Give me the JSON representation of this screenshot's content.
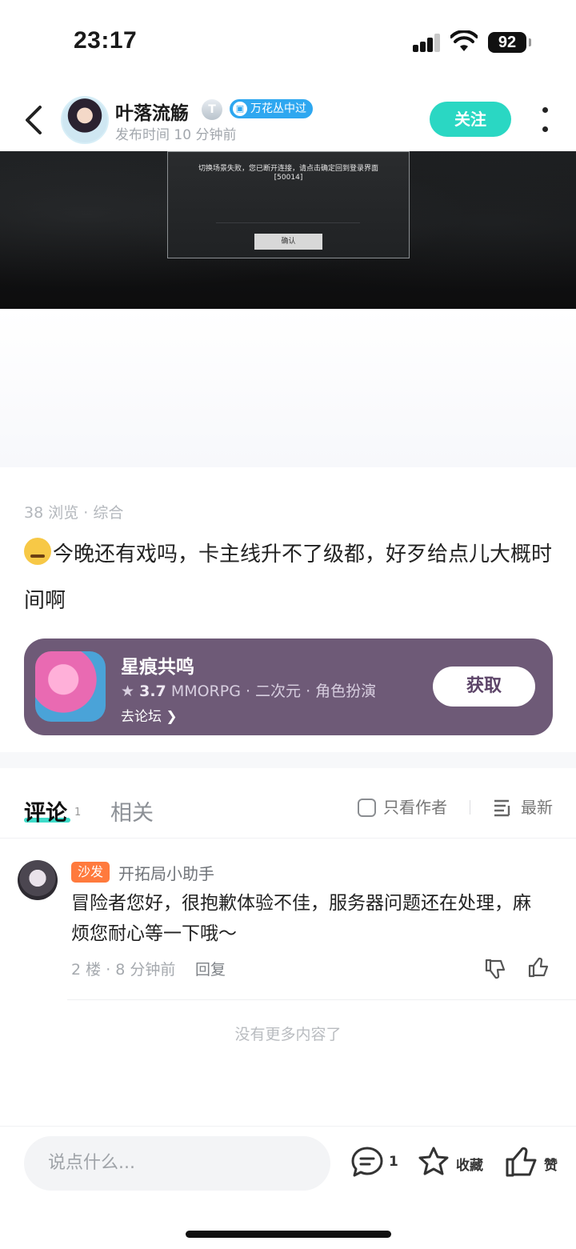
{
  "status_bar": {
    "time": "23:17",
    "battery": "92"
  },
  "header": {
    "author_name": "叶落流觞",
    "level_badge": "T",
    "tag_badge": "万花丛中过",
    "post_time": "发布时间 10 分钟前",
    "follow_label": "关注"
  },
  "post_image": {
    "dialog_message_line1": "切换场景失败，您已断开连接，请点击确定回到登录界面",
    "dialog_message_line2": "[50014]",
    "dialog_button": "确认"
  },
  "post": {
    "views": "38 浏览",
    "separator": "·",
    "category": "综合",
    "text": "今晚还有戏吗，卡主线升不了级都，好歹给点儿大概时间啊"
  },
  "game_card": {
    "title": "星痕共鸣",
    "rating": "3.7",
    "tags": "MMORPG · 二次元 · 角色扮演",
    "forum_link": "去论坛",
    "get_label": "获取"
  },
  "tabs": {
    "comment_label": "评论",
    "comment_count": "1",
    "related_label": "相关",
    "author_only_label": "只看作者",
    "sort_label": "最新"
  },
  "comment": {
    "badge": "沙发",
    "user": "开拓局小助手",
    "text": "冒险者您好，很抱歉体验不佳，服务器问题还在处理，麻烦您耐心等一下哦～",
    "floor": "2 楼",
    "time": "8 分钟前",
    "reply_label": "回复"
  },
  "no_more_text": "没有更多内容了",
  "bottom_bar": {
    "input_placeholder": "说点什么...",
    "comment_count": "1",
    "favorite_label": "收藏",
    "like_label": "赞"
  },
  "colors": {
    "accent": "#2ad7c3",
    "game_card_bg": "#6e5a77",
    "sofa_badge": "#ff7a3d",
    "tag_badge": "#2ea7f0"
  }
}
